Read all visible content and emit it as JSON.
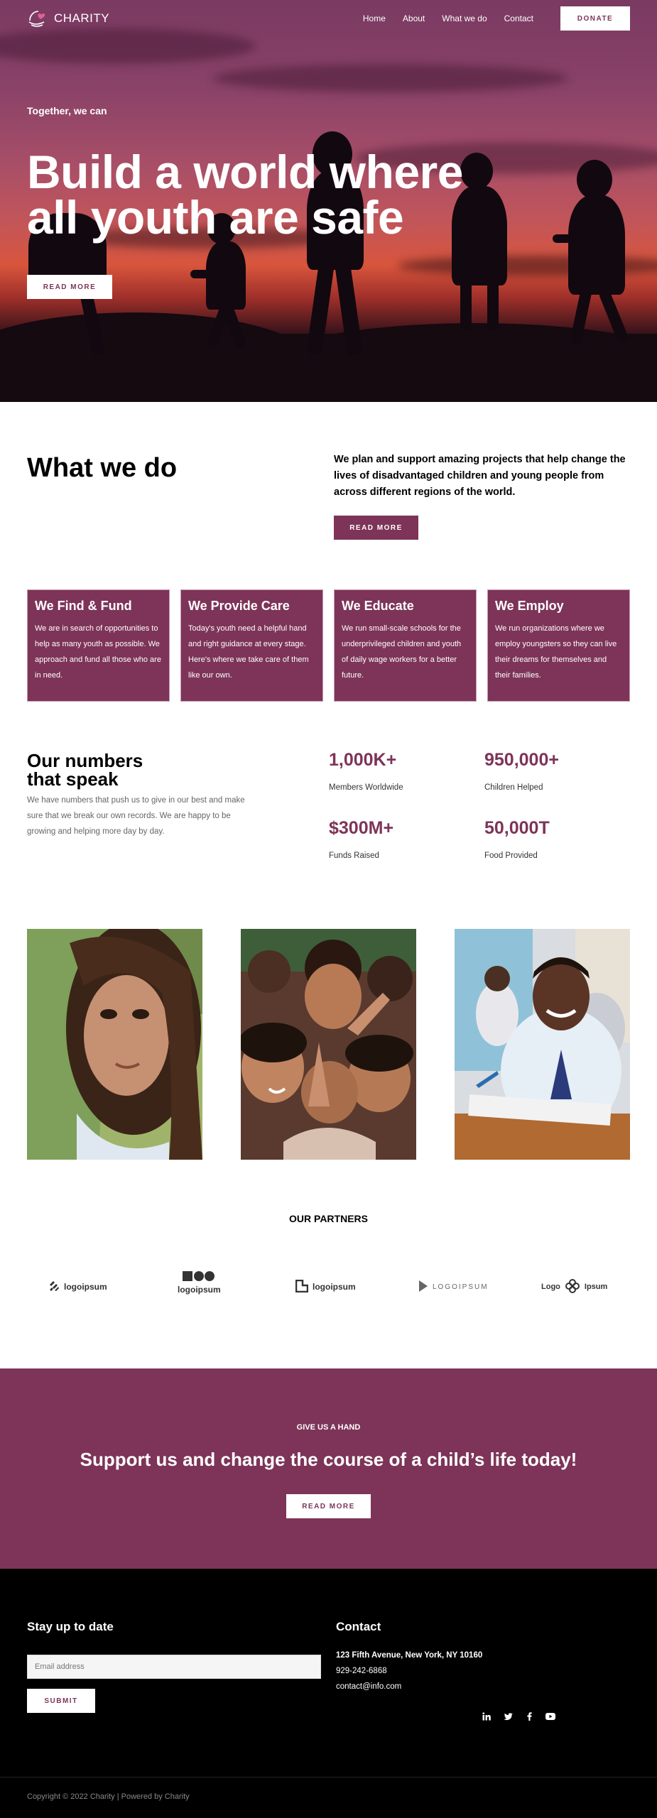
{
  "nav": {
    "logo_text": "CHARITY",
    "links": [
      "Home",
      "About",
      "What we do",
      "Contact"
    ],
    "donate_label": "DONATE"
  },
  "hero": {
    "kicker": "Together, we can",
    "title": "Build a world where all youth are safe",
    "button_label": "READ MORE"
  },
  "what_we_do": {
    "title": "What we do",
    "text": "We plan and support amazing projects that help change the lives of disadvantaged children and young people from across different regions of the world.",
    "button_label": "READ MORE",
    "cards": [
      {
        "title": "We Find & Fund",
        "text": "We are in search of opportunities to help as many youth as possible. We approach and fund all those who are in need."
      },
      {
        "title": "We Provide Care",
        "text": "Today's youth need a helpful hand and right guidance at every stage. Here's where we take care of them like our own."
      },
      {
        "title": "We Educate",
        "text": "We run small-scale schools for the underprivileged children and youth of daily wage workers for a better future."
      },
      {
        "title": "We Employ",
        "text": "We run organizations where we employ youngsters so they can live their dreams for themselves and their families."
      }
    ]
  },
  "numbers": {
    "title_line1": "Our numbers",
    "title_line2": "that speak",
    "description": "We have numbers that push us to give in our best and make sure that we break our own records. We are happy to be growing and helping more day by day.",
    "stats": [
      {
        "value": "1,000K+",
        "label": "Members Worldwide"
      },
      {
        "value": "950,000+",
        "label": "Children Helped"
      },
      {
        "value": "$300M+",
        "label": "Funds Raised"
      },
      {
        "value": "50,000T",
        "label": "Food Provided"
      }
    ]
  },
  "partners": {
    "title": "OUR PARTNERS",
    "logos": [
      "logoipsum",
      "logoipsum",
      "logoipsum",
      "LOGOIPSUM",
      "Logo",
      "Ipsum"
    ]
  },
  "cta": {
    "kicker": "GIVE US A HAND",
    "title": "Support us and change the course of a child’s life today!",
    "button_label": "READ MORE"
  },
  "footer": {
    "newsletter_title": "Stay up to date",
    "email_placeholder": "Email address",
    "submit_label": "SUBMIT",
    "contact_title": "Contact",
    "address": "123 Fifth Avenue, New York, NY 10160",
    "phone": "929-242-6868",
    "email": "contact@info.com",
    "socials": [
      "linkedin-icon",
      "twitter-icon",
      "facebook-icon",
      "youtube-icon"
    ],
    "copyright": "Copyright © 2022 Charity | Powered by Charity"
  },
  "colors": {
    "brand": "#7d3458",
    "footer_bg": "#000000"
  }
}
